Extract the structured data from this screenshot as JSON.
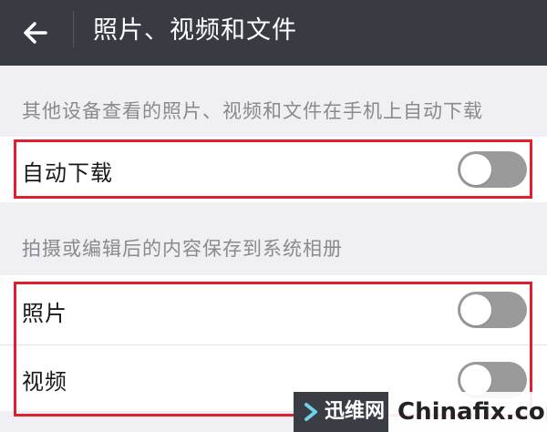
{
  "header": {
    "back_icon": "arrow-left-icon",
    "title": "照片、视频和文件"
  },
  "auto_download_section": {
    "header": "其他设备查看的照片、视频和文件在手机上自动下载",
    "row": {
      "label": "自动下载",
      "enabled": false
    }
  },
  "save_section": {
    "header": "拍摄或编辑后的内容保存到系统相册",
    "rows": [
      {
        "label": "照片",
        "enabled": false
      },
      {
        "label": "视频",
        "enabled": false
      }
    ]
  },
  "watermark": {
    "brand_cn": "迅维网",
    "brand_en": "Chinafix.com"
  },
  "colors": {
    "appbar": "#383b42",
    "highlight": "#e0202e",
    "toggle_off": "#9a9a9a",
    "background": "#efeff4"
  }
}
